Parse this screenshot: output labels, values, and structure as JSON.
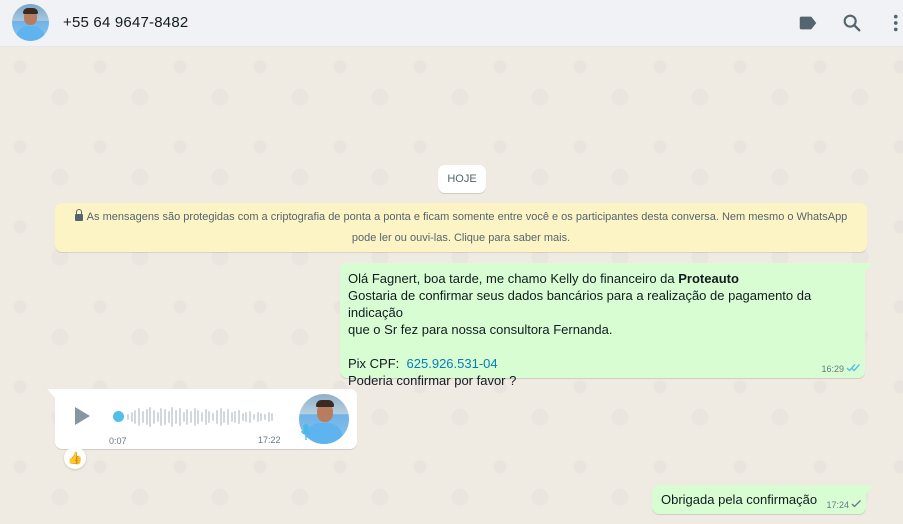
{
  "header": {
    "contact_name": "+55 64 9647-8482",
    "icons": [
      "label-icon",
      "search-icon",
      "more-vertical-icon"
    ]
  },
  "chat": {
    "day_divider": "HOJE",
    "encryption_notice": {
      "line1": "As mensagens são protegidas com a criptografia de ponta a ponta e ficam somente entre você e os participantes desta conversa. Nem mesmo o WhatsApp",
      "line2": "pode ler ou ouvi-las. Clique para saber mais."
    },
    "messages": [
      {
        "direction": "outgoing",
        "line1_prefix": "Olá Fagnert, boa tarde, me chamo Kelly do financeiro da ",
        "line1_bold": "Proteauto",
        "line2": "Gostaria de confirmar seus dados bancários para a realização de pagamento da indicação",
        "line3": "que o Sr fez para nossa consultora Fernanda.",
        "pix_label": "Pix CPF:",
        "pix_value": "625.926.531-04",
        "line5": "Poderia confirmar por favor ?",
        "time": "16:29",
        "status": "read"
      },
      {
        "direction": "incoming",
        "type": "voice",
        "duration": "0:07",
        "time": "17:22",
        "played_fraction": 0.0,
        "reaction": "👍"
      },
      {
        "direction": "outgoing",
        "text": "Obrigada pela confirmação",
        "time": "17:24",
        "status": "delivered"
      }
    ]
  },
  "colors": {
    "outgoing_bubble": "#d9fdd3",
    "incoming_bubble": "#ffffff",
    "notice_bg": "#fdf4c5",
    "read_ticks": "#53bdeb",
    "link": "#027eb5"
  }
}
